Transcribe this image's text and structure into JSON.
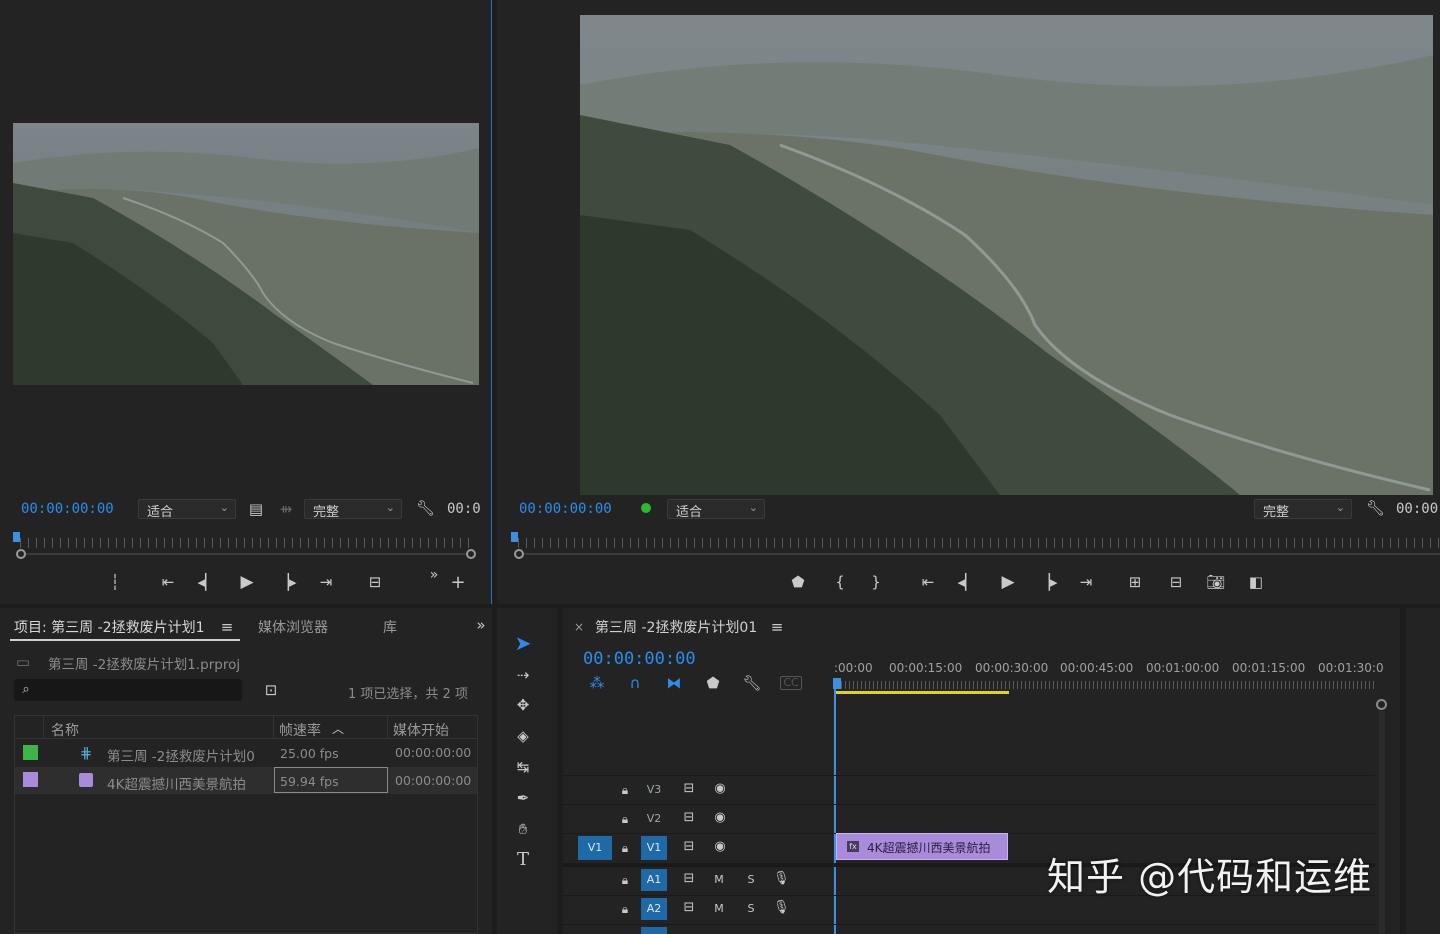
{
  "source_monitor": {
    "timecode": "00:00:00:00",
    "zoom": "适合",
    "quality": "完整",
    "duration_partial": "00:0"
  },
  "program_monitor": {
    "timecode": "00:00:00:00",
    "zoom": "适合",
    "quality": "完整",
    "duration_partial": "00:00"
  },
  "project_panel": {
    "tabs": [
      "项目: 第三周 -2拯救废片计划1",
      "媒体浏览器",
      "库"
    ],
    "file_name": "第三周 -2拯救废片计划1.prproj",
    "selection_status": "1 项已选择，共 2 项",
    "columns": [
      "名称",
      "帧速率",
      "媒体开始"
    ],
    "rows": [
      {
        "swatch": "#3fb24a",
        "name": "第三周 -2拯救废片计划0",
        "fps": "25.00 fps",
        "start": "00:00:00:00"
      },
      {
        "swatch": "#a98bdc",
        "name": "4K超震撼川西美景航拍",
        "fps": "59.94 fps",
        "start": "00:00:00:00"
      }
    ]
  },
  "timeline": {
    "sequence_title": "第三周 -2拯救废片计划01",
    "timecode": "00:00:00:00",
    "ruler": [
      ":00:00",
      "00:00:15:00",
      "00:00:30:00",
      "00:00:45:00",
      "00:01:00:00",
      "00:01:15:00",
      "00:01:30:0"
    ],
    "tracks": {
      "video": [
        "V3",
        "V2",
        "V1"
      ],
      "audio": [
        "A1",
        "A2"
      ],
      "source_patch": "V1",
      "mute": "M",
      "solo": "S"
    },
    "clip_label": "4K超震撼川西美景航拍"
  },
  "watermark": "知乎 @代码和运维",
  "colors": {
    "accent": "#2d8ceb",
    "clip": "#a98bdc",
    "playhead": "#3d8fe0",
    "work_area": "#e3d21a"
  }
}
